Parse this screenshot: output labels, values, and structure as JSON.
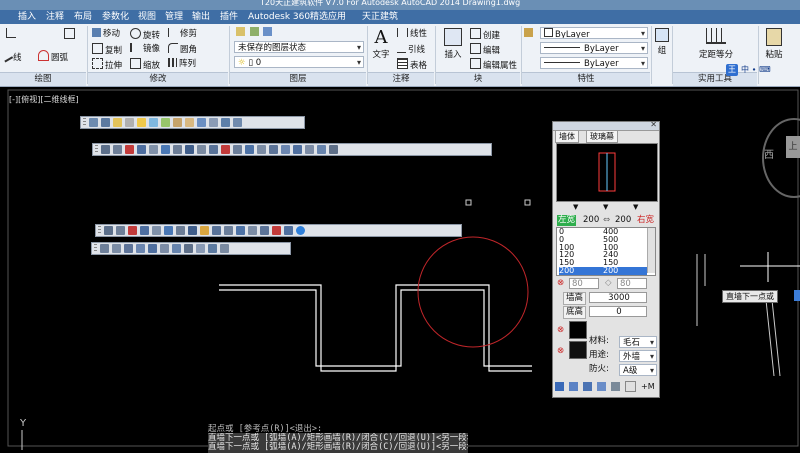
{
  "title": {
    "text": "T20天正建筑软件 V7.0 For Autodesk AutoCAD 2014      Drawing1.dwg"
  },
  "tabs": [
    "插入",
    "注释",
    "布局",
    "参数化",
    "视图",
    "管理",
    "输出",
    "插件",
    "Autodesk 360",
    "精选应用",
    "天正建筑"
  ],
  "ribbon": {
    "draw_panel": {
      "items": [
        "线",
        "圆弧"
      ],
      "label": "绘图"
    },
    "modify_panel": {
      "items": [
        "移动",
        "旋转",
        "修剪",
        "复制",
        "镜像",
        "圆角",
        "拉伸",
        "缩放",
        "阵列"
      ],
      "label": "修改"
    },
    "layer_panel": {
      "state": "未保存的图层状态",
      "current": "0",
      "label": "图层"
    },
    "annotation_panel": {
      "big": "文字",
      "items": [
        "线性",
        "引线",
        "表格"
      ],
      "label": "注释"
    },
    "block_panel": {
      "big": "插入",
      "items": [
        "创建",
        "编辑",
        "编辑属性"
      ],
      "label": "块"
    },
    "properties_panel": {
      "color": "ByLayer",
      "linetype": "ByLayer",
      "lineweight": "ByLayer",
      "label": "特性"
    },
    "group_panel": {
      "big": "组"
    },
    "utilities_panel": {
      "big": "定距等分",
      "label": "实用工具"
    },
    "clipboard_panel": {
      "big": "粘贴"
    }
  },
  "viewport": {
    "label": "[-][俯视][二维线框]",
    "ucs_label": "Y",
    "viewcube_west": "西",
    "viewcube_side": "上"
  },
  "wall_dialog": {
    "tabs": [
      "墙体",
      "玻璃幕"
    ],
    "left_label": "左宽",
    "left_value": "200",
    "total_value": "200",
    "right_label": "右宽",
    "thickness_list": [
      [
        "0",
        "400"
      ],
      [
        "0",
        "500"
      ],
      [
        "100",
        "100"
      ],
      [
        "120",
        "240"
      ],
      [
        "150",
        "150"
      ],
      [
        "200",
        "200"
      ]
    ],
    "left_spin": "80",
    "right_spin": "80",
    "height_label": "墙高",
    "height_value": "3000",
    "base_label": "底高",
    "base_value": "0",
    "material_label": "材料:",
    "material_value": "毛石",
    "usage_label": "用途:",
    "usage_value": "外墙",
    "fire_label": "防火:",
    "fire_value": "A级"
  },
  "tooltip": {
    "text": "直墙下一点或"
  },
  "command_lines": [
    "起点或 [参考点(R)]<退出>:",
    "直墙下一点或 [弧墙(A)/矩形画墙(R)/闭合(C)/回退(U)]<另一段>:",
    "直墙下一点或 [弧墙(A)/矩形画墙(R)/闭合(C)/回退(U)]<另一段>:"
  ],
  "colors": {
    "ribbon_bg": "#eef2f7",
    "tabbar": "#3f6ea5",
    "canvas": "#000000",
    "wall_lines": "#ffffff",
    "circle": "#c0262a"
  }
}
